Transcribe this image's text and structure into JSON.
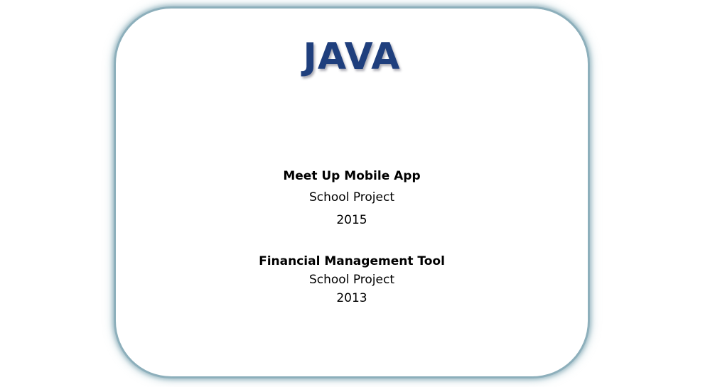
{
  "card": {
    "title": "JAVA",
    "title_color": "#1f3f7d",
    "border_color": "#7aa4b2",
    "projects": [
      {
        "name": "Meet Up Mobile App",
        "type": "School Project",
        "year": "2015"
      },
      {
        "name": "Financial Management Tool",
        "type": "School Project",
        "year": "2013"
      }
    ]
  }
}
